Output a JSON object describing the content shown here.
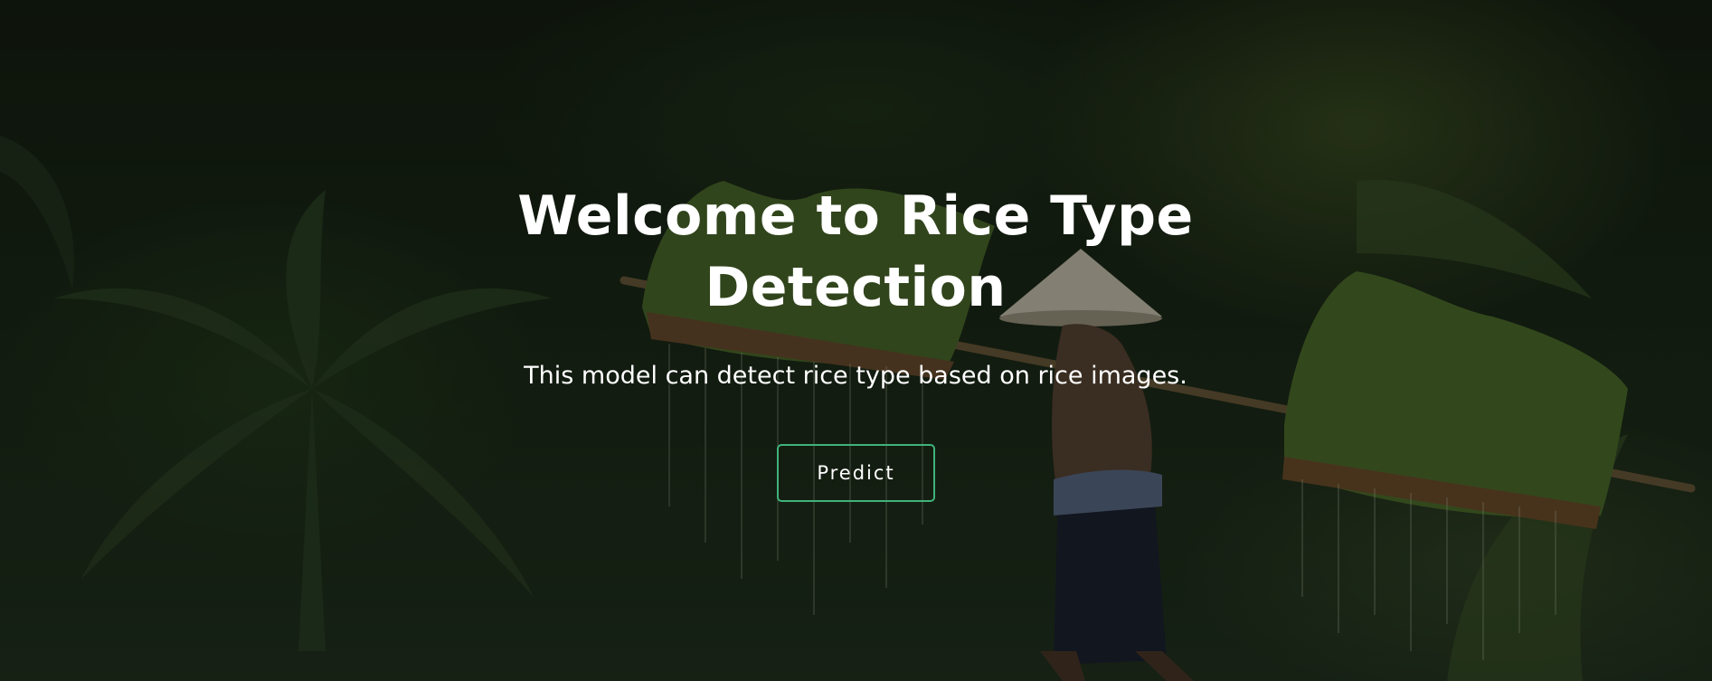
{
  "hero": {
    "title": "Welcome to Rice Type Detection",
    "subtitle": "This model can detect rice type based on rice images.",
    "predict_label": "Predict",
    "button_border_color": "#3fb37b",
    "text_color": "#ffffff"
  }
}
